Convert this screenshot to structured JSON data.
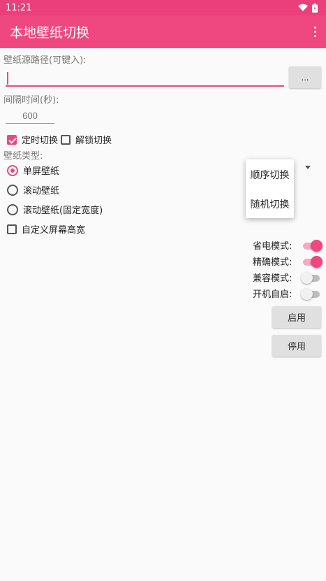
{
  "status_bar": {
    "time": "11:21",
    "icons": [
      "wifi-icon",
      "battery-icon"
    ]
  },
  "app_bar": {
    "title": "本地壁纸切换",
    "menu_icon": "overflow-menu-icon"
  },
  "source": {
    "label": "壁纸源路径(可键入):",
    "value": "",
    "browse_label": "..."
  },
  "interval": {
    "label": "间隔时间(秒):",
    "placeholder": "600"
  },
  "options": {
    "timed_switch": "定时切换",
    "unlock_switch": "解锁切换",
    "timed_checked": true,
    "unlock_checked": false
  },
  "wallpaper_type": {
    "label": "壁纸类型:",
    "options": [
      "单屏壁纸",
      "滚动壁纸",
      "滚动壁纸(固定宽度)"
    ],
    "selected": 0,
    "custom_screen": "自定义屏幕高宽",
    "custom_checked": false
  },
  "order_popup": {
    "items": [
      "顺序切换",
      "随机切换"
    ]
  },
  "modes": [
    {
      "label": "省电模式:",
      "on": true
    },
    {
      "label": "精确模式:",
      "on": true
    },
    {
      "label": "兼容模式:",
      "on": false
    },
    {
      "label": "开机自启:",
      "on": false
    }
  ],
  "actions": {
    "enable": "启用",
    "disable": "停用"
  },
  "colors": {
    "accent": "#ef4780",
    "status_bar": "#ea3f7a"
  }
}
